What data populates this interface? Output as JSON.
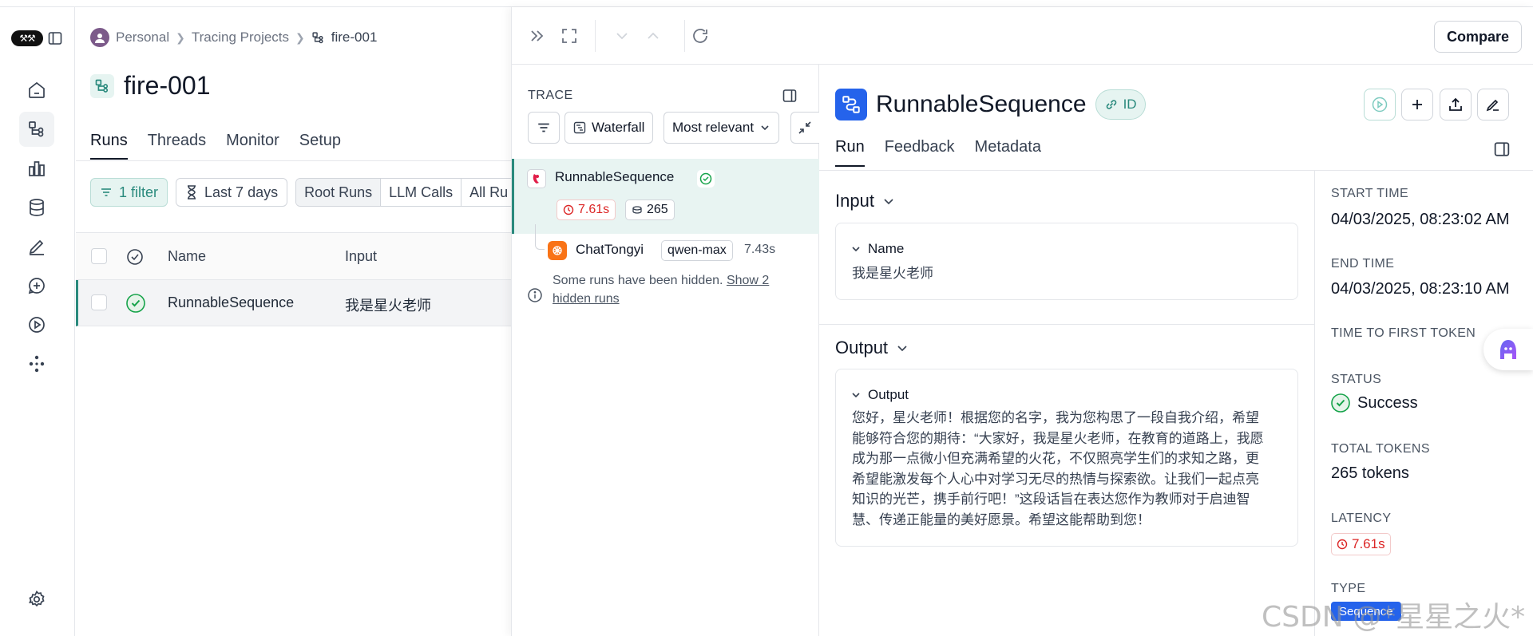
{
  "colors": {
    "accent_teal": "#2a8a7d",
    "brand_blue": "#2563eb",
    "latency_red": "#dc2626"
  },
  "breadcrumb": {
    "workspace": "Personal",
    "section": "Tracing Projects",
    "project": "fire-001"
  },
  "project": {
    "title": "fire-001"
  },
  "tabs": [
    "Runs",
    "Threads",
    "Monitor",
    "Setup"
  ],
  "filters": {
    "filter_count": "1 filter",
    "date_range": "Last 7 days",
    "segments": [
      "Root Runs",
      "LLM Calls",
      "All Ru"
    ]
  },
  "table": {
    "headers": {
      "name": "Name",
      "input": "Input"
    },
    "rows": [
      {
        "name": "RunnableSequence",
        "input": "我是星火老师",
        "status": "success"
      }
    ]
  },
  "drawer": {
    "compare_label": "Compare",
    "trace": {
      "label": "TRACE",
      "waterfall": "Waterfall",
      "sort": "Most relevant",
      "root": {
        "name": "RunnableSequence",
        "latency": "7.61s",
        "tokens": "265"
      },
      "child": {
        "name": "ChatTongyi",
        "model": "qwen-max",
        "latency": "7.43s"
      },
      "hidden_note": "Some runs have been hidden.",
      "hidden_link": "Show 2 hidden runs"
    },
    "run": {
      "title": "RunnableSequence",
      "id_label": "ID",
      "tabs": [
        "Run",
        "Feedback",
        "Metadata"
      ],
      "input": {
        "section": "Input",
        "key": "Name",
        "value": "我是星火老师"
      },
      "output": {
        "section": "Output",
        "key": "Output",
        "lines": [
          "您好，星火老师！根据您的名字，我为您构思了一段自我介绍，希望",
          "能够符合您的期待：“大家好，我是星火老师，在教育的道路上，我愿",
          "成为那一点微小但充满希望的火花，不仅照亮学生们的求知之路，更",
          "希望能激发每个人心中对学习无尽的热情与探索欲。让我们一起点亮",
          "知识的光芒，携手前行吧！”这段话旨在表达您作为教师对于启迪智",
          "慧、传递正能量的美好愿景。希望这能帮助到您！"
        ]
      },
      "meta": {
        "start_time_label": "START TIME",
        "start_time": "04/03/2025, 08:23:02 AM",
        "end_time_label": "END TIME",
        "end_time": "04/03/2025, 08:23:10 AM",
        "ttft_label": "TIME TO FIRST TOKEN",
        "status_label": "STATUS",
        "status": "Success",
        "tokens_label": "TOTAL TOKENS",
        "tokens": "265 tokens",
        "latency_label": "LATENCY",
        "latency": "7.61s",
        "type_label": "TYPE",
        "type": "Sequence"
      }
    }
  },
  "watermark": "CSDN @*星星之火*"
}
